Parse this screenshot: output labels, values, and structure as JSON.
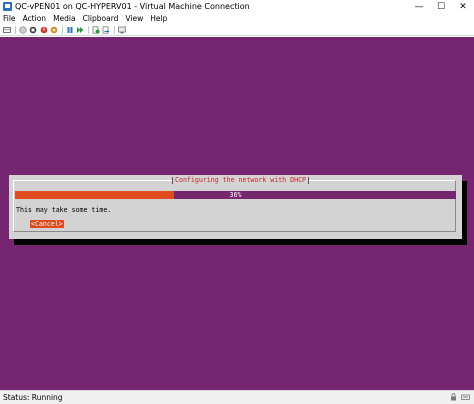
{
  "window": {
    "title": "QC-vPEN01 on QC-HYPERV01 - Virtual Machine Connection",
    "minimize": "—",
    "maximize": "☐",
    "close": "✕"
  },
  "menu": [
    "File",
    "Action",
    "Media",
    "Clipboard",
    "View",
    "Help"
  ],
  "toolbar": {
    "icons": [
      "ctrl-alt-del-icon",
      "start-icon",
      "turn-off-icon",
      "shut-down-icon",
      "save-icon",
      "pause-icon",
      "reset-icon",
      "checkpoint-icon",
      "revert-icon",
      "enhanced-session-icon"
    ]
  },
  "installer": {
    "dialog_title": "Configuring the network with DHCP",
    "progress_percent": 36,
    "progress_label": "36%",
    "message": "This may take some time.",
    "cancel_label": "<Cancel>"
  },
  "colors": {
    "screen_background": "#762570",
    "dialog_background": "#d3d3d3",
    "accent": "#e04b1f",
    "title_text": "#c92a2a"
  },
  "status": {
    "text": "Status: Running"
  }
}
